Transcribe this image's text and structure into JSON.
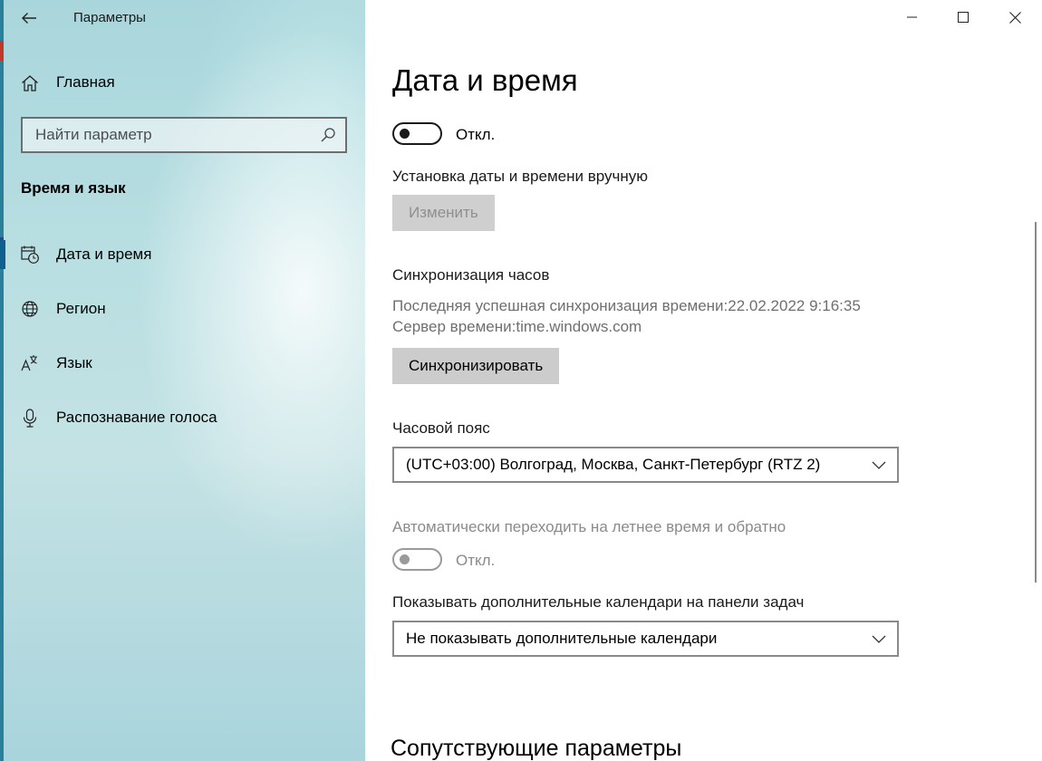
{
  "window": {
    "app_title": "Параметры"
  },
  "sidebar": {
    "home_label": "Главная",
    "search_placeholder": "Найти параметр",
    "section_title": "Время и язык",
    "items": [
      {
        "label": "Дата и время",
        "icon": "calendar-clock-icon",
        "active": true
      },
      {
        "label": "Регион",
        "icon": "globe-icon",
        "active": false
      },
      {
        "label": "Язык",
        "icon": "language-icon",
        "active": false
      },
      {
        "label": "Распознавание голоса",
        "icon": "microphone-icon",
        "active": false
      }
    ]
  },
  "main": {
    "page_title": "Дата и время",
    "auto_time_toggle": {
      "state_label": "Откл."
    },
    "manual_set": {
      "label": "Установка даты и времени вручную",
      "button": "Изменить"
    },
    "sync": {
      "title": "Синхронизация часов",
      "last_sync": "Последняя успешная синхронизация времени:22.02.2022 9:16:35",
      "server": "Сервер времени:time.windows.com",
      "button": "Синхронизировать"
    },
    "timezone": {
      "label": "Часовой пояс",
      "value": "(UTC+03:00) Волгоград, Москва, Санкт-Петербург (RTZ 2)"
    },
    "dst": {
      "label": "Автоматически переходить на летнее время и обратно",
      "state_label": "Откл."
    },
    "calendars": {
      "label": "Показывать дополнительные календари на панели задач",
      "value": "Не показывать дополнительные календари"
    },
    "related_title": "Сопутствующие параметры"
  }
}
